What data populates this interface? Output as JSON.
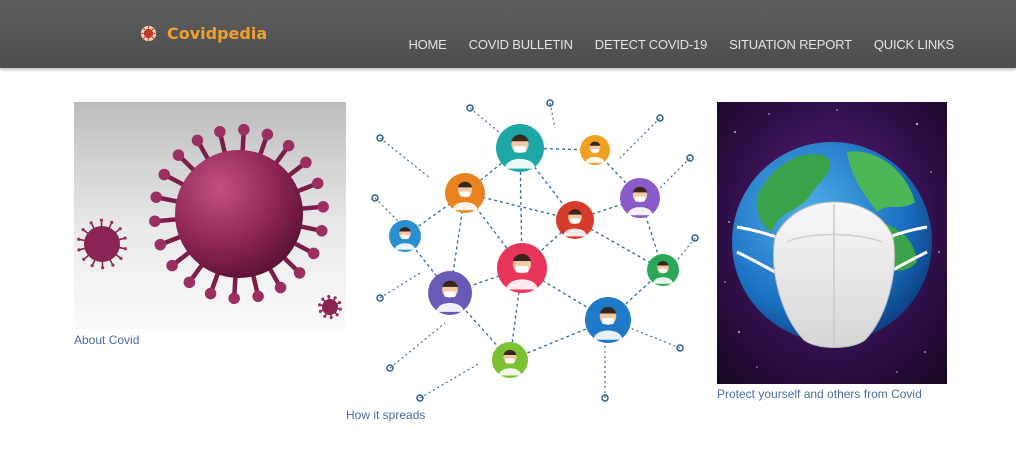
{
  "brand": {
    "name": "Covidpedia",
    "logo_icon": "virus-icon",
    "color": "#f0a030"
  },
  "nav": {
    "items": [
      {
        "label": "HOME"
      },
      {
        "label": "COVID BULLETIN"
      },
      {
        "label": "DETECT COVID-19"
      },
      {
        "label": "SITUATION REPORT"
      },
      {
        "label": "QUICK LINKS"
      }
    ]
  },
  "cards": [
    {
      "caption": "About Covid",
      "image": "coronavirus-illustration"
    },
    {
      "caption": "How it spreads",
      "image": "people-network-illustration"
    },
    {
      "caption": "Protect yourself and others from Covid",
      "image": "earth-with-mask-illustration"
    }
  ],
  "colors": {
    "navbar": "#555555",
    "nav_text": "#e4e4e4",
    "caption": "#4a6da0",
    "virus": "#9a2a5a"
  }
}
